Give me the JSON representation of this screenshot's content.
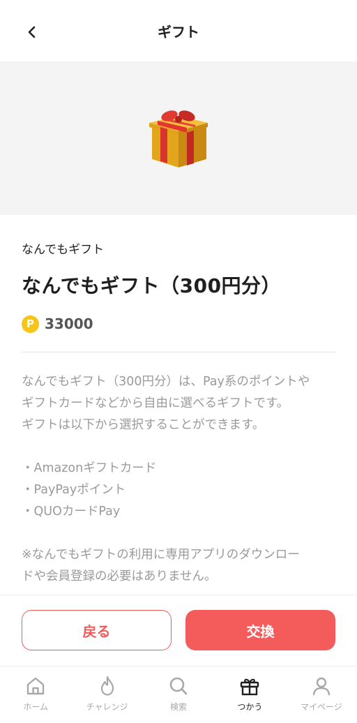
{
  "header": {
    "title": "ギフト"
  },
  "item": {
    "category": "なんでもギフト",
    "title": "なんでもギフト（300円分）",
    "point_badge": "P",
    "points": "33000"
  },
  "description": {
    "lines": [
      "なんでもギフト（300円分）は、Pay系のポイントや",
      "ギフトカードなどから自由に選べるギフトです。",
      "ギフトは以下から選択することができます。"
    ],
    "options": [
      "・Amazonギフトカード",
      "・PayPayポイント",
      "・QUOカードPay"
    ],
    "notes": [
      "※なんでもギフトの利用に専用アプリのダウンロー",
      "ドや会員登録の必要はありません。"
    ]
  },
  "actions": {
    "back_label": "戻る",
    "exchange_label": "交換"
  },
  "tabs": [
    {
      "label": "ホーム",
      "icon": "home-icon"
    },
    {
      "label": "チャレンジ",
      "icon": "flame-icon"
    },
    {
      "label": "検索",
      "icon": "search-icon"
    },
    {
      "label": "つかう",
      "icon": "gift-icon",
      "active": true
    },
    {
      "label": "マイページ",
      "icon": "person-icon"
    }
  ],
  "colors": {
    "accent": "#f45b5b",
    "point_badge": "#f5c518",
    "muted_text": "#9a9a9a"
  }
}
